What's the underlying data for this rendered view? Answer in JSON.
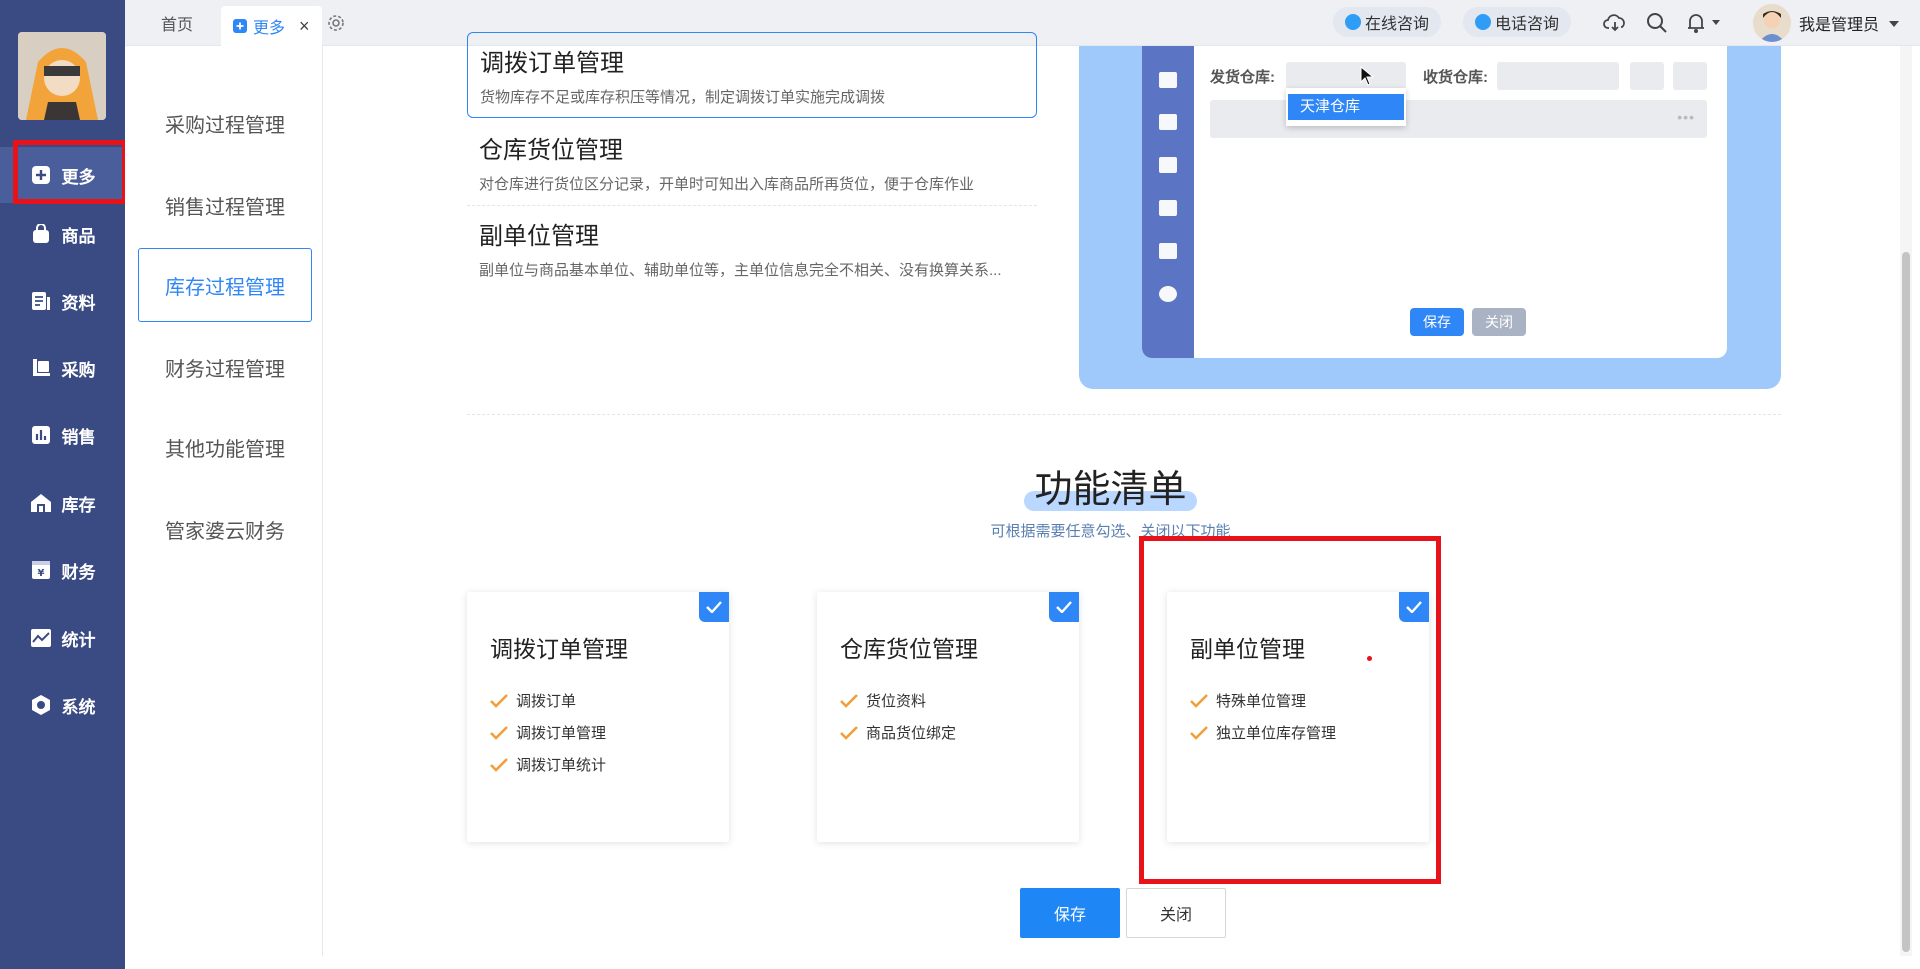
{
  "sidebar": {
    "items": [
      {
        "label": "更多",
        "icon": "plus-square-icon"
      },
      {
        "label": "商品",
        "icon": "bag-icon"
      },
      {
        "label": "资料",
        "icon": "document-icon"
      },
      {
        "label": "采购",
        "icon": "cart-icon"
      },
      {
        "label": "销售",
        "icon": "bar-chart-icon"
      },
      {
        "label": "库存",
        "icon": "warehouse-icon"
      },
      {
        "label": "财务",
        "icon": "yen-icon"
      },
      {
        "label": "统计",
        "icon": "trend-chart-icon"
      },
      {
        "label": "系统",
        "icon": "hexagon-settings-icon"
      }
    ]
  },
  "topbar": {
    "tabs": [
      {
        "label": "首页"
      },
      {
        "label": "更多"
      }
    ],
    "online_consult": "在线咨询",
    "phone_consult": "电话咨询",
    "user_name": "我是管理员"
  },
  "subnav": {
    "items": [
      {
        "label": "采购过程管理"
      },
      {
        "label": "销售过程管理"
      },
      {
        "label": "库存过程管理"
      },
      {
        "label": "财务过程管理"
      },
      {
        "label": "其他功能管理"
      },
      {
        "label": "管家婆云财务"
      }
    ]
  },
  "features": [
    {
      "title": "调拨订单管理",
      "desc": "货物库存不足或库存积压等情况，制定调拨订单实施完成调拨"
    },
    {
      "title": "仓库货位管理",
      "desc": "对仓库进行货位区分记录，开单时可知出入库商品所再货位，便于仓库作业"
    },
    {
      "title": "副单位管理",
      "desc": "副单位与商品基本单位、辅助单位等，主单位信息完全不相关、没有换算关系..."
    }
  ],
  "preview": {
    "ship_label": "发货仓库:",
    "recv_label": "收货仓库:",
    "dropdown_option": "天津仓库",
    "more_dots": "•••",
    "save": "保存",
    "close": "关闭"
  },
  "section": {
    "title": "功能清单",
    "subtitle": "可根据需要任意勾选、关闭以下功能"
  },
  "cards": [
    {
      "title": "调拨订单管理",
      "items": [
        "调拨订单",
        "调拨订单管理",
        "调拨订单统计"
      ],
      "checked": true
    },
    {
      "title": "仓库货位管理",
      "items": [
        "货位资料",
        "商品货位绑定"
      ],
      "checked": true
    },
    {
      "title": "副单位管理",
      "items": [
        "特殊单位管理",
        "独立单位库存管理"
      ],
      "checked": true
    }
  ],
  "buttons": {
    "save": "保存",
    "close": "关闭"
  },
  "colors": {
    "primary": "#2f86f6",
    "sidebar": "#3a4b84",
    "highlight": "#e8121a",
    "check": "#f0a03c"
  }
}
